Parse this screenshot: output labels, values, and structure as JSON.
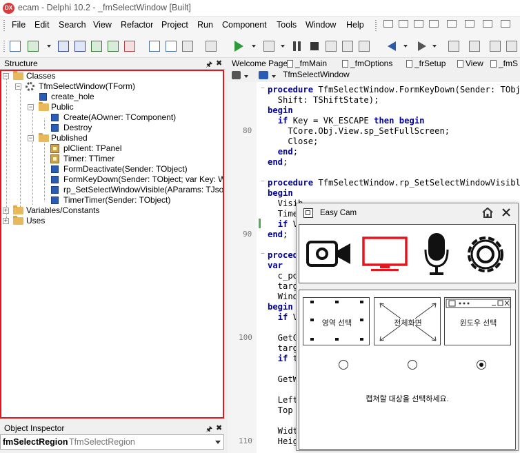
{
  "window": {
    "app_icon_text": "DX",
    "title": "ecam - Delphi 10.2 - _fmSelectWindow [Built]"
  },
  "menu": [
    "File",
    "Edit",
    "Search",
    "View",
    "Refactor",
    "Project",
    "Run",
    "Component",
    "Tools",
    "Window",
    "Help"
  ],
  "structure": {
    "title": "Structure",
    "nodes": [
      {
        "label": "Classes",
        "icon": "folder-icon",
        "depth": 0
      },
      {
        "label": "TfmSelectWindow(TForm)",
        "icon": "class-gear-icon",
        "depth": 1
      },
      {
        "label": "create_hole",
        "icon": "method-icon",
        "depth": 2
      },
      {
        "label": "Public",
        "icon": "folder-icon",
        "depth": 2
      },
      {
        "label": "Create(AOwner: TComponent)",
        "icon": "method-icon",
        "depth": 3
      },
      {
        "label": "Destroy",
        "icon": "method-icon",
        "depth": 3
      },
      {
        "label": "Published",
        "icon": "folder-icon",
        "depth": 2
      },
      {
        "label": "plClient: TPanel",
        "icon": "field-icon",
        "depth": 3
      },
      {
        "label": "Timer: TTimer",
        "icon": "field-icon",
        "depth": 3
      },
      {
        "label": "FormDeactivate(Sender: TObject)",
        "icon": "method-icon",
        "depth": 3
      },
      {
        "label": "FormKeyDown(Sender: TObject; var Key: Wo",
        "icon": "method-icon",
        "depth": 3
      },
      {
        "label": "rp_SetSelectWindowVisible(AParams: TJsonD",
        "icon": "method-icon",
        "depth": 3
      },
      {
        "label": "TimerTimer(Sender: TObject)",
        "icon": "method-icon",
        "depth": 3
      },
      {
        "label": "Variables/Constants",
        "icon": "folder-icon",
        "depth": 0
      },
      {
        "label": "Uses",
        "icon": "folder-icon",
        "depth": 0
      }
    ]
  },
  "object_inspector": {
    "title": "Object Inspector",
    "selected_name": "fmSelectRegion",
    "selected_type": "TfmSelectRegion"
  },
  "editor": {
    "tabs": [
      "Welcome Page",
      "_fmMain",
      "_fmOptions",
      "_frSetup",
      "View",
      "_fmS"
    ],
    "class_combo": "TfmSelectWindow",
    "line_numbers": [
      "80",
      "90",
      "100",
      "110"
    ]
  },
  "easycam": {
    "title": "Easy Cam",
    "options": [
      "영역 선택",
      "전체화면",
      "윈도우 선택"
    ],
    "selected_option": 2,
    "message": "캡쳐할 대상을 선택하세요."
  }
}
